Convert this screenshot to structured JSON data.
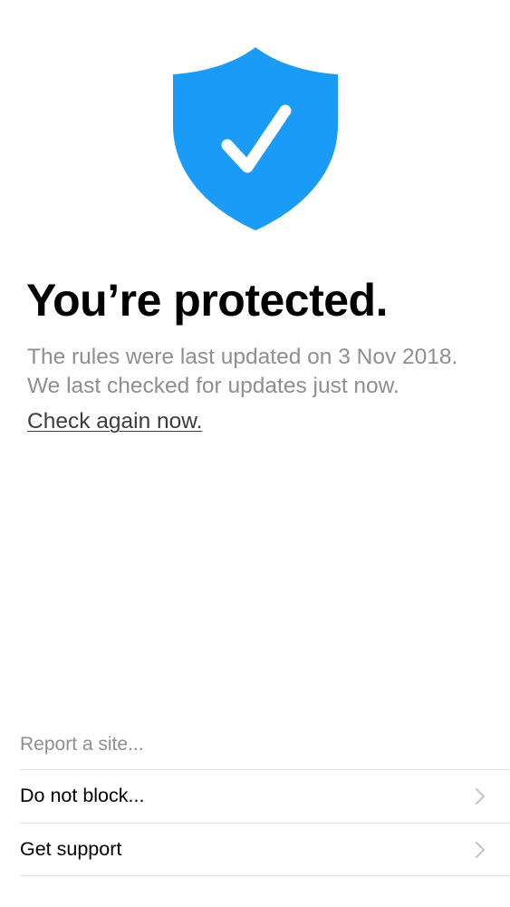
{
  "status": {
    "icon": "shield-checkmark-icon",
    "accent_color": "#1a9bf7",
    "title": "You’re protected.",
    "line1": "The rules were last updated on 3 Nov 2018.",
    "line2": "We last checked for updates just now.",
    "check_link": "Check again now."
  },
  "menu": {
    "report_label": "Report a site...",
    "items": [
      {
        "label": "Do not block...",
        "icon": "chevron-right-icon"
      },
      {
        "label": "Get support",
        "icon": "chevron-right-icon"
      }
    ]
  }
}
